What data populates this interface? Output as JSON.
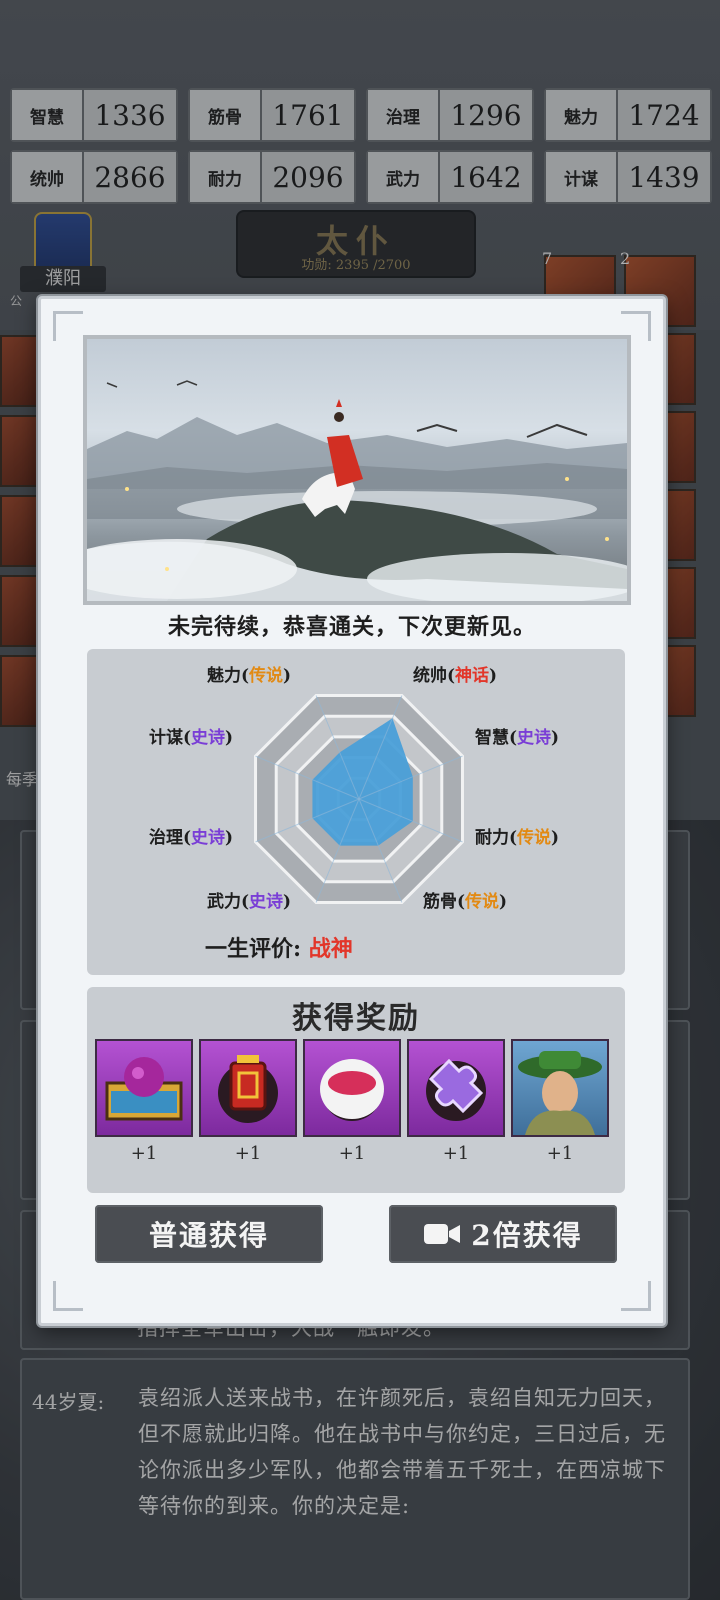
{
  "stats": [
    {
      "label": "智慧",
      "value": "1336"
    },
    {
      "label": "筋骨",
      "value": "1761"
    },
    {
      "label": "治理",
      "value": "1296"
    },
    {
      "label": "魅力",
      "value": "1724"
    },
    {
      "label": "统帅",
      "value": "2866"
    },
    {
      "label": "耐力",
      "value": "2096"
    },
    {
      "label": "武力",
      "value": "1642"
    },
    {
      "label": "计谋",
      "value": "1439"
    }
  ],
  "rank": {
    "title": "太仆",
    "merit": "功勋: 2395 /2700"
  },
  "city": {
    "name": "濮阳",
    "sub": "公"
  },
  "hero_badges": [
    "7",
    "2"
  ],
  "background_event": {
    "prev_line": "指挥全军出击，大战一触即发。",
    "age": "44岁夏:",
    "text": "袁绍派人送来战书，在许颜死后，袁绍自知无力回天，但不愿就此归降。他在战书中与你约定，三日过后，无论你派出多少军队，他都会带着五千死士，在西凉城下等待你的到来。你的决定是:"
  },
  "side_label": "每季",
  "modal": {
    "ending_text": "未完待续，恭喜通关，下次更新见。",
    "attributes": [
      {
        "name": "统帅",
        "grade": "神话",
        "grade_type": "myth",
        "level": 0.78
      },
      {
        "name": "智慧",
        "grade": "史诗",
        "grade_type": "epic",
        "level": 0.52
      },
      {
        "name": "耐力",
        "grade": "传说",
        "grade_type": "legend",
        "level": 0.52
      },
      {
        "name": "筋骨",
        "grade": "传说",
        "grade_type": "legend",
        "level": 0.45
      },
      {
        "name": "武力",
        "grade": "史诗",
        "grade_type": "epic",
        "level": 0.45
      },
      {
        "name": "治理",
        "grade": "史诗",
        "grade_type": "epic",
        "level": 0.45
      },
      {
        "name": "计谋",
        "grade": "史诗",
        "grade_type": "epic",
        "level": 0.45
      },
      {
        "name": "魅力",
        "grade": "传说",
        "grade_type": "legend",
        "level": 0.45
      }
    ],
    "lifetime_label": "一生评价:",
    "lifetime_value": "战神",
    "reward_title": "获得奖励",
    "rewards": [
      {
        "icon": "treasure-chest-icon",
        "count": "+1"
      },
      {
        "icon": "red-lantern-icon",
        "count": "+1"
      },
      {
        "icon": "red-bowl-icon",
        "count": "+1"
      },
      {
        "icon": "puzzle-piece-icon",
        "count": "+1"
      },
      {
        "icon": "hero-portrait-icon",
        "count": "+1"
      }
    ],
    "btn_normal": "普通获得",
    "btn_double": "2倍获得"
  },
  "colors": {
    "myth": "#e2362a",
    "legend": "#e28a14",
    "epic": "#7a3ed6",
    "radar_fill": "#4a9fd8"
  }
}
